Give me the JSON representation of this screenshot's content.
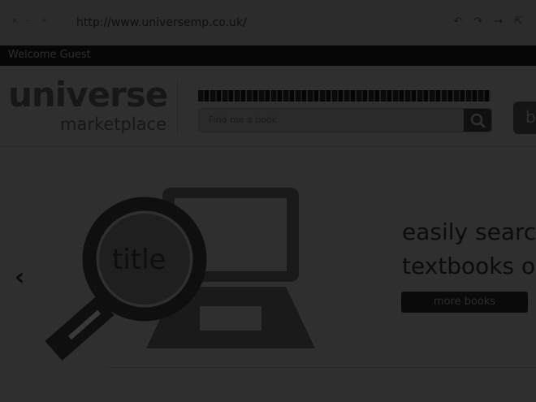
{
  "browser": {
    "url": "http://www.universemp.co.uk/",
    "window_buttons": [
      "×",
      "–",
      "+"
    ],
    "nav_icons": [
      "↶",
      "↷",
      "→",
      "⇱"
    ]
  },
  "topbar": {
    "welcome": "Welcome Guest"
  },
  "header": {
    "logo_main": "universe",
    "logo_sub": "marketplace",
    "search_placeholder": "Find me a book",
    "right_button_label": "b"
  },
  "hero": {
    "magnifier_text": "title",
    "headline_line1": "easily search",
    "headline_line2": "textbooks o",
    "button_label": "more books",
    "prev_arrow": "‹"
  }
}
